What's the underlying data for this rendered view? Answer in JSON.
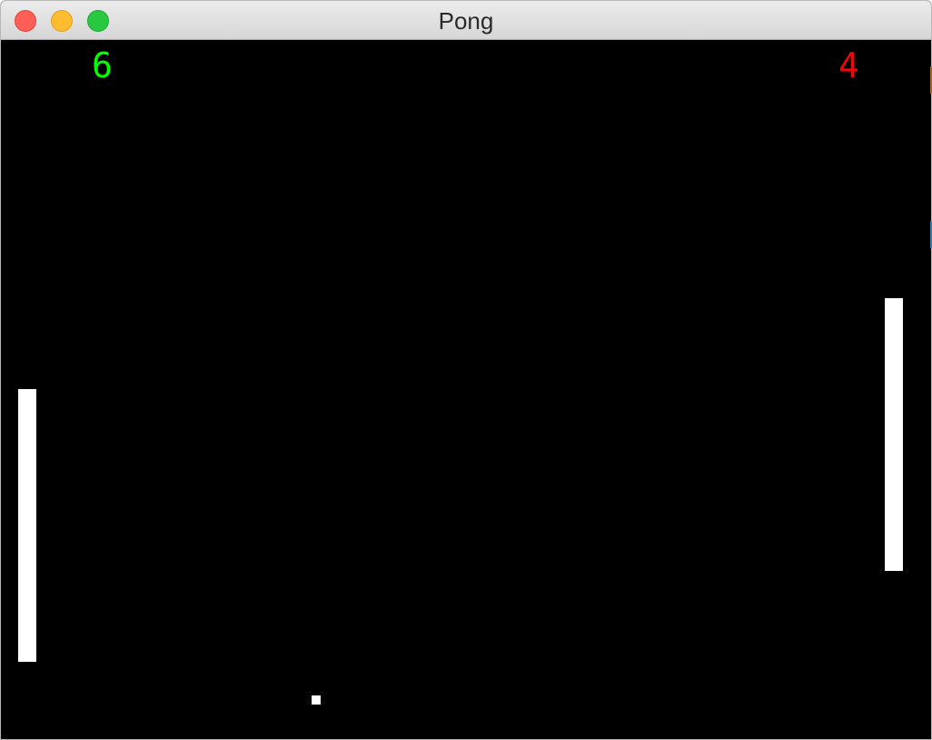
{
  "window": {
    "title": "Pong"
  },
  "scores": {
    "left": "6",
    "right": "4",
    "left_color": "#00ff00",
    "right_color": "#ff0000"
  },
  "colors": {
    "background": "#000000",
    "paddle": "#ffffff",
    "ball": "#ffffff"
  }
}
